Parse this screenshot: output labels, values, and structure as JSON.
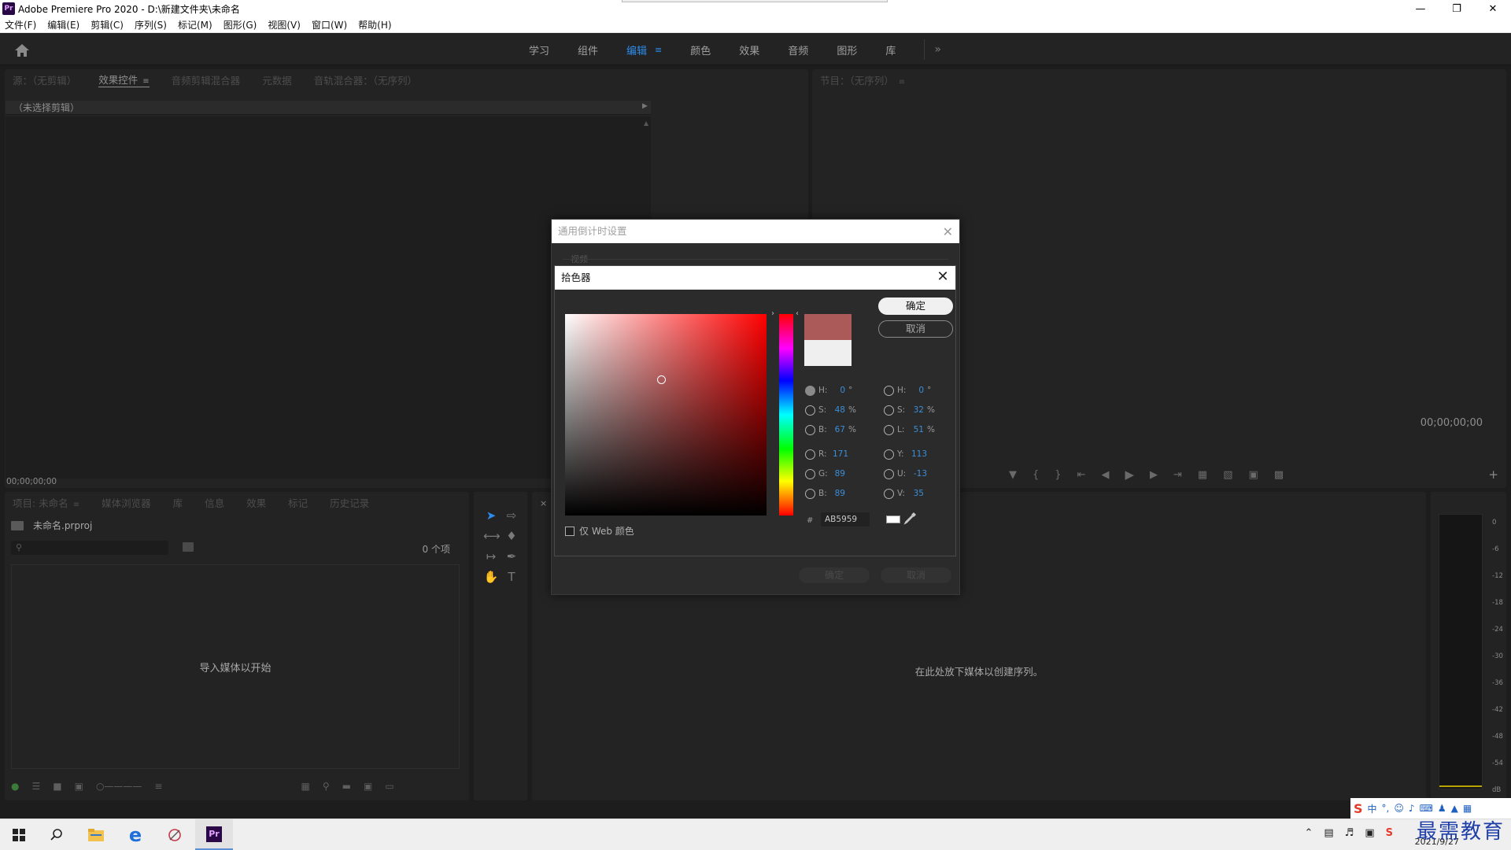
{
  "window": {
    "title": "Adobe Premiere Pro 2020 - D:\\新建文件夹\\未命名",
    "app_icon": "Pr"
  },
  "menu": [
    "文件(F)",
    "编辑(E)",
    "剪辑(C)",
    "序列(S)",
    "标记(M)",
    "图形(G)",
    "视图(V)",
    "窗口(W)",
    "帮助(H)"
  ],
  "workspaces": {
    "tabs": [
      "学习",
      "组件",
      "编辑",
      "颜色",
      "效果",
      "音频",
      "图形",
      "库"
    ],
    "active": "编辑",
    "more": "»"
  },
  "source_panel": {
    "tabs": [
      "源：（无剪辑）",
      "效果控件",
      "音频剪辑混合器",
      "元数据",
      "音轨混合器：（无序列）"
    ],
    "active_tab": "效果控件",
    "no_clip": "（未选择剪辑）",
    "timecode": "00;00;00;00"
  },
  "program_panel": {
    "tab": "节目：（无序列）",
    "timecode": "00;00;00;00"
  },
  "project_panel": {
    "tabs": [
      "项目: 未命名",
      "媒体浏览器",
      "库",
      "信息",
      "效果",
      "标记",
      "历史记录"
    ],
    "file": "未命名.prproj",
    "count": "0 个项",
    "empty_message": "导入媒体以开始"
  },
  "timeline_panel": {
    "close": "×",
    "empty_message": "在此处放下媒体以创建序列。"
  },
  "audio_meter": {
    "labels": [
      "0",
      "-6",
      "-12",
      "-18",
      "-24",
      "-30",
      "-36",
      "-42",
      "-48",
      "-54",
      "dB"
    ]
  },
  "timer_dialog": {
    "title": "通用倒计时设置",
    "section": "视频",
    "ok": "确定",
    "cancel": "取消"
  },
  "color_picker": {
    "title": "拾色器",
    "ok": "确定",
    "cancel": "取消",
    "hex_prefix": "#",
    "hex": "AB5959",
    "new_color": "#ab5959",
    "old_color": "#efefef",
    "web_only": "仅 Web 颜色",
    "hsb": {
      "H": {
        "label": "H:",
        "value": "0",
        "unit": "°"
      },
      "S": {
        "label": "S:",
        "value": "48",
        "unit": "%"
      },
      "B": {
        "label": "B:",
        "value": "67",
        "unit": "%"
      }
    },
    "hsl": {
      "H": {
        "label": "H:",
        "value": "0",
        "unit": "°"
      },
      "S": {
        "label": "S:",
        "value": "32",
        "unit": "%"
      },
      "L": {
        "label": "L:",
        "value": "51",
        "unit": "%"
      }
    },
    "rgb": {
      "R": {
        "label": "R:",
        "value": "171"
      },
      "G": {
        "label": "G:",
        "value": "89"
      },
      "B": {
        "label": "B:",
        "value": "89"
      }
    },
    "yuv": {
      "Y": {
        "label": "Y:",
        "value": "113"
      },
      "U": {
        "label": "U:",
        "value": "-13"
      },
      "V": {
        "label": "V:",
        "value": "35"
      }
    },
    "selected_mode": "H"
  },
  "taskbar": {
    "date": "2021/9/27",
    "ime": "中",
    "watermark": "最需教育"
  },
  "colors": {
    "accent": "#2d8ceb",
    "panel_bg": "#232323",
    "meter_level": "#b8a400"
  }
}
